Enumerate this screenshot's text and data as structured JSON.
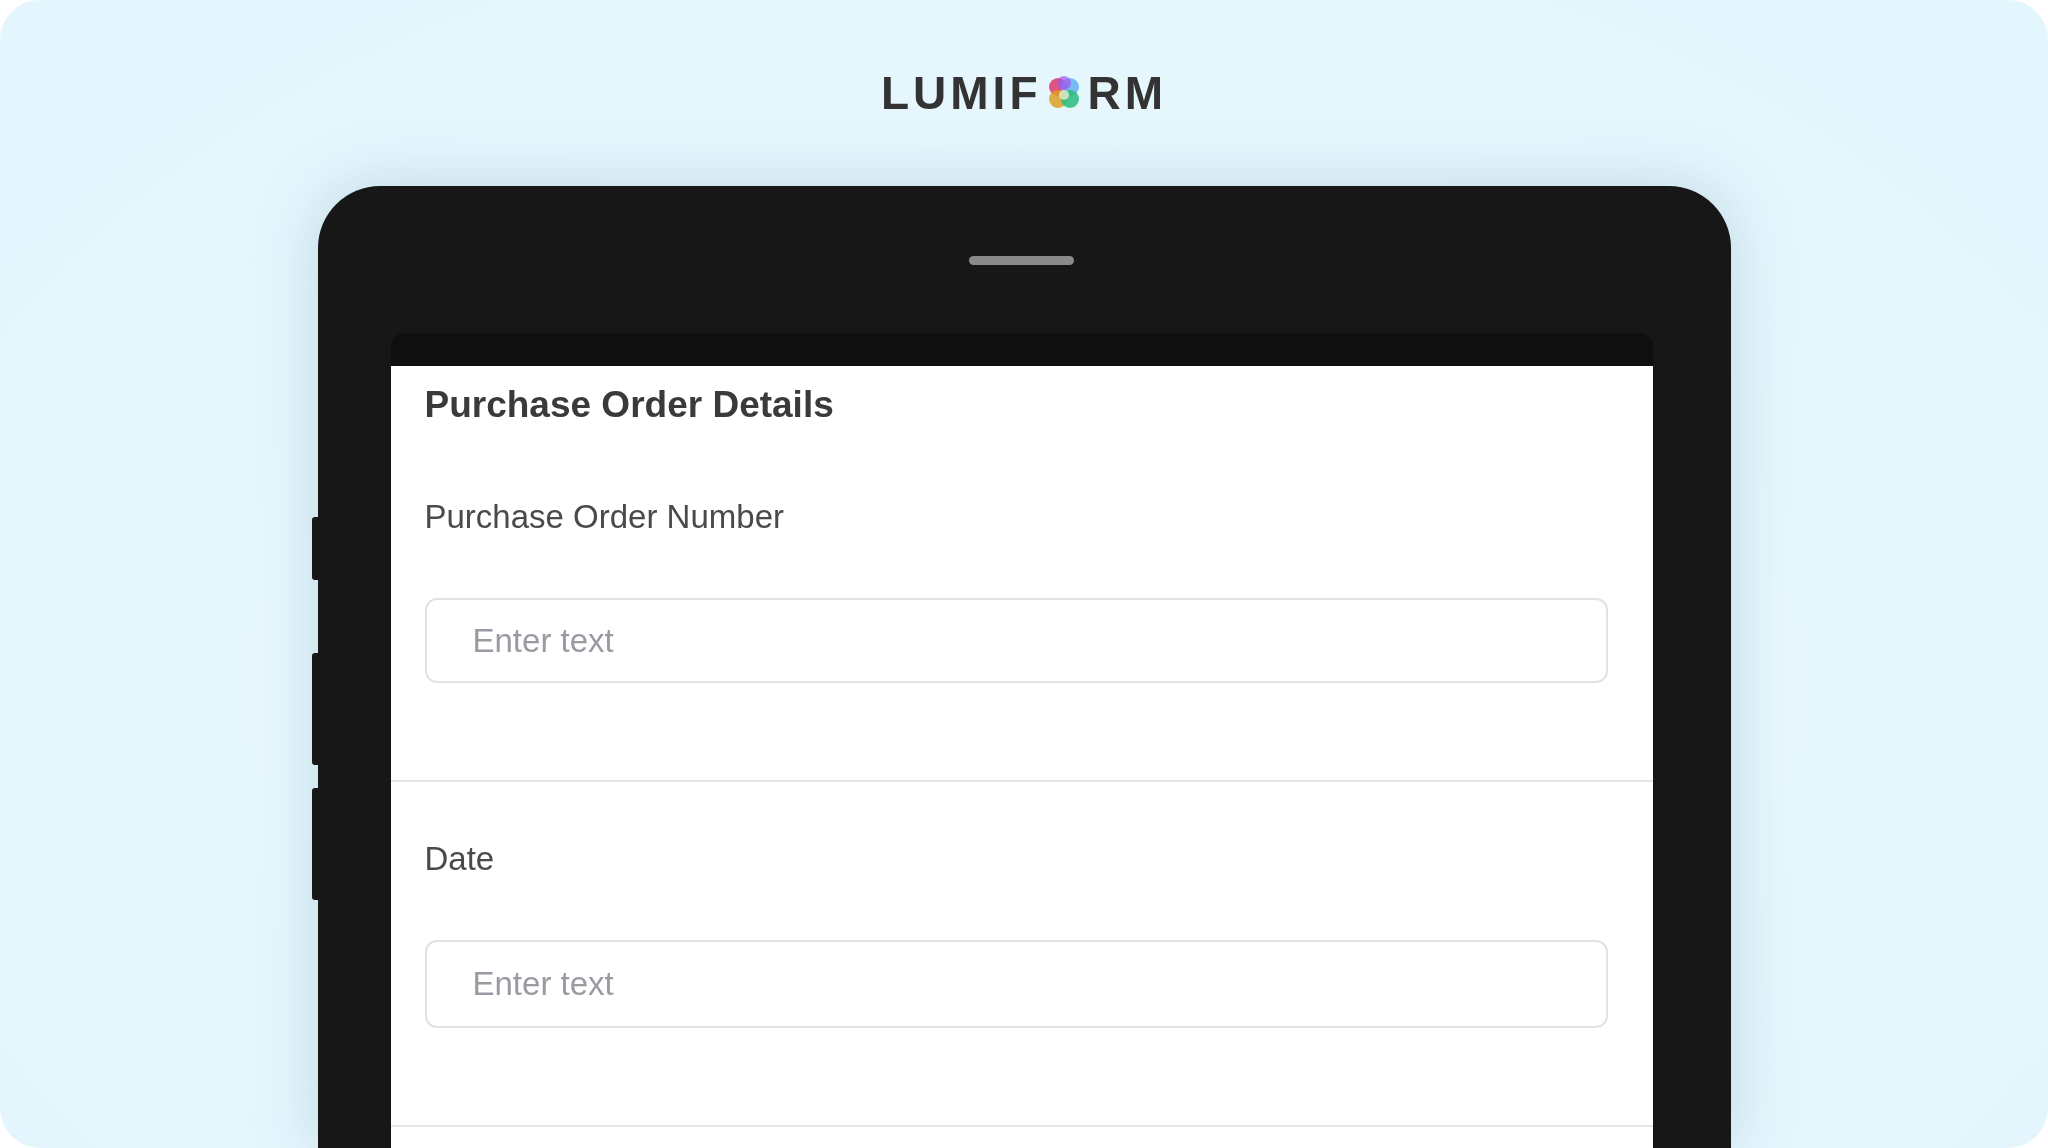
{
  "logo": {
    "text_before_icon": "LUMIF",
    "text_after_icon": "RM"
  },
  "form": {
    "title": "Purchase Order Details",
    "fields": [
      {
        "label": "Purchase Order Number",
        "placeholder": "Enter text"
      },
      {
        "label": "Date",
        "placeholder": "Enter text"
      }
    ]
  }
}
